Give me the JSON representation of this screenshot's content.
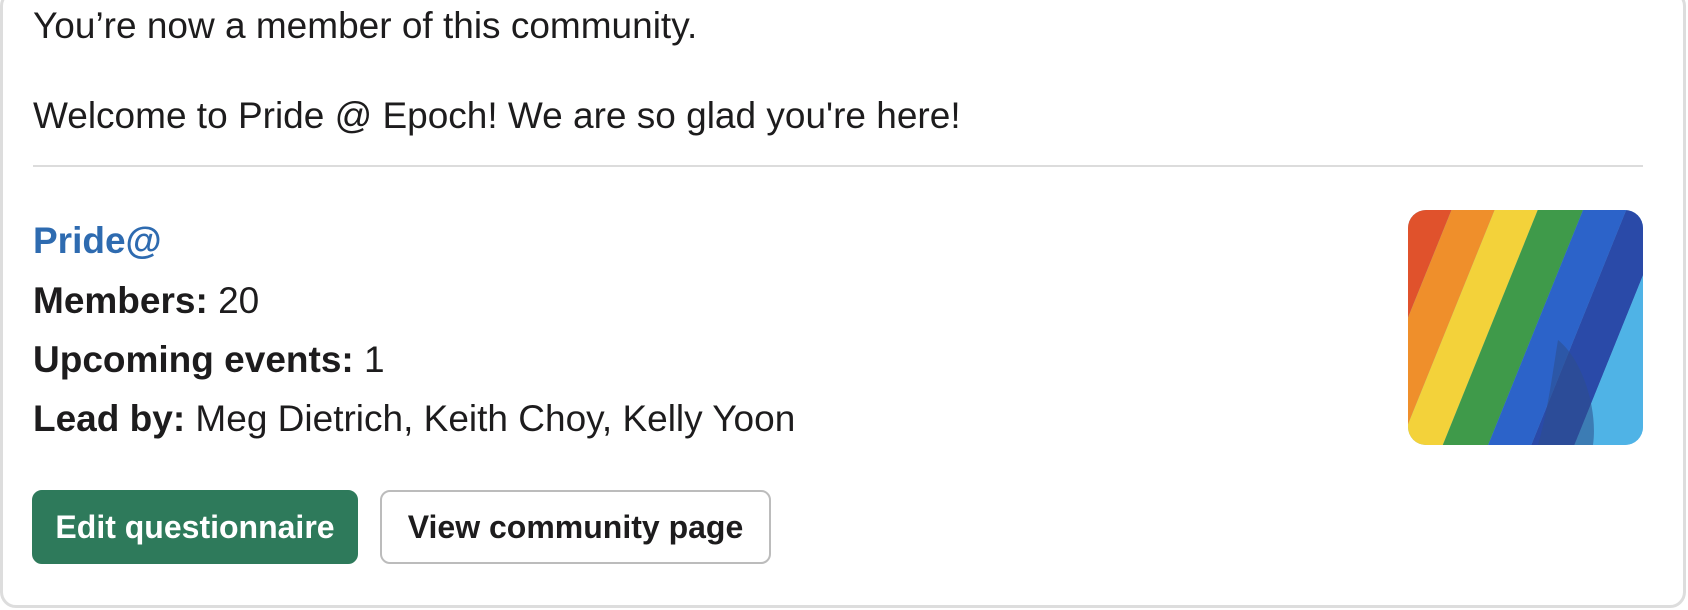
{
  "message": {
    "intro": "You’re now a member of this community.",
    "welcome": "Welcome to Pride @ Epoch! We are so glad you're here!"
  },
  "community": {
    "name": "Pride@",
    "members_label": "Members:",
    "members_value": "20",
    "events_label": "Upcoming events:",
    "events_value": "1",
    "leads_label": "Lead by:",
    "leads_value": "Meg Dietrich, Keith Choy, Kelly Yoon",
    "image_icon": "rainbow-flag-image"
  },
  "actions": {
    "primary_label": "Edit questionnaire",
    "secondary_label": "View community page"
  },
  "colors": {
    "link": "#2e6bb0",
    "primary_button": "#2e7a5b",
    "border": "#dddddd"
  }
}
